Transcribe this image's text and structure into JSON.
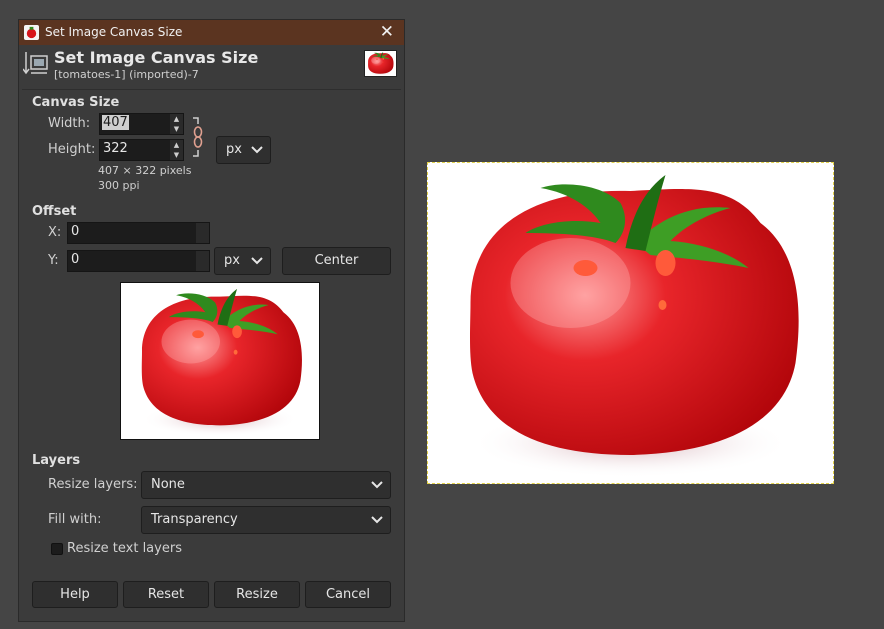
{
  "window": {
    "title": "Set Image Canvas Size"
  },
  "header": {
    "title": "Set Image Canvas Size",
    "subtitle": "[tomatoes-1] (imported)-7"
  },
  "canvas_size": {
    "section": "Canvas Size",
    "width_label": "Width:",
    "width_value": "407",
    "height_label": "Height:",
    "height_value": "322",
    "unit": "px",
    "pixels_info": "407 × 322 pixels",
    "ppi_info": "300 ppi"
  },
  "offset": {
    "section": "Offset",
    "x_label": "X:",
    "x_value": "0",
    "y_label": "Y:",
    "y_value": "0",
    "unit": "px",
    "center_label": "Center"
  },
  "layers": {
    "section": "Layers",
    "resize_layers_label": "Resize layers:",
    "resize_layers_value": "None",
    "fill_with_label": "Fill with:",
    "fill_with_value": "Transparency",
    "resize_text_layers_label": "Resize text layers"
  },
  "buttons": {
    "help": "Help",
    "reset": "Reset",
    "resize": "Resize",
    "cancel": "Cancel"
  },
  "icons": {
    "app": "gimp-icon",
    "close": "close-icon",
    "header": "canvas-size-icon",
    "chain": "chain-link-icon",
    "dropdown": "chevron-down-icon"
  },
  "colors": {
    "titlebar": "#5b3420",
    "tomato": "#d7141a",
    "leaf": "#2f8a1e"
  }
}
